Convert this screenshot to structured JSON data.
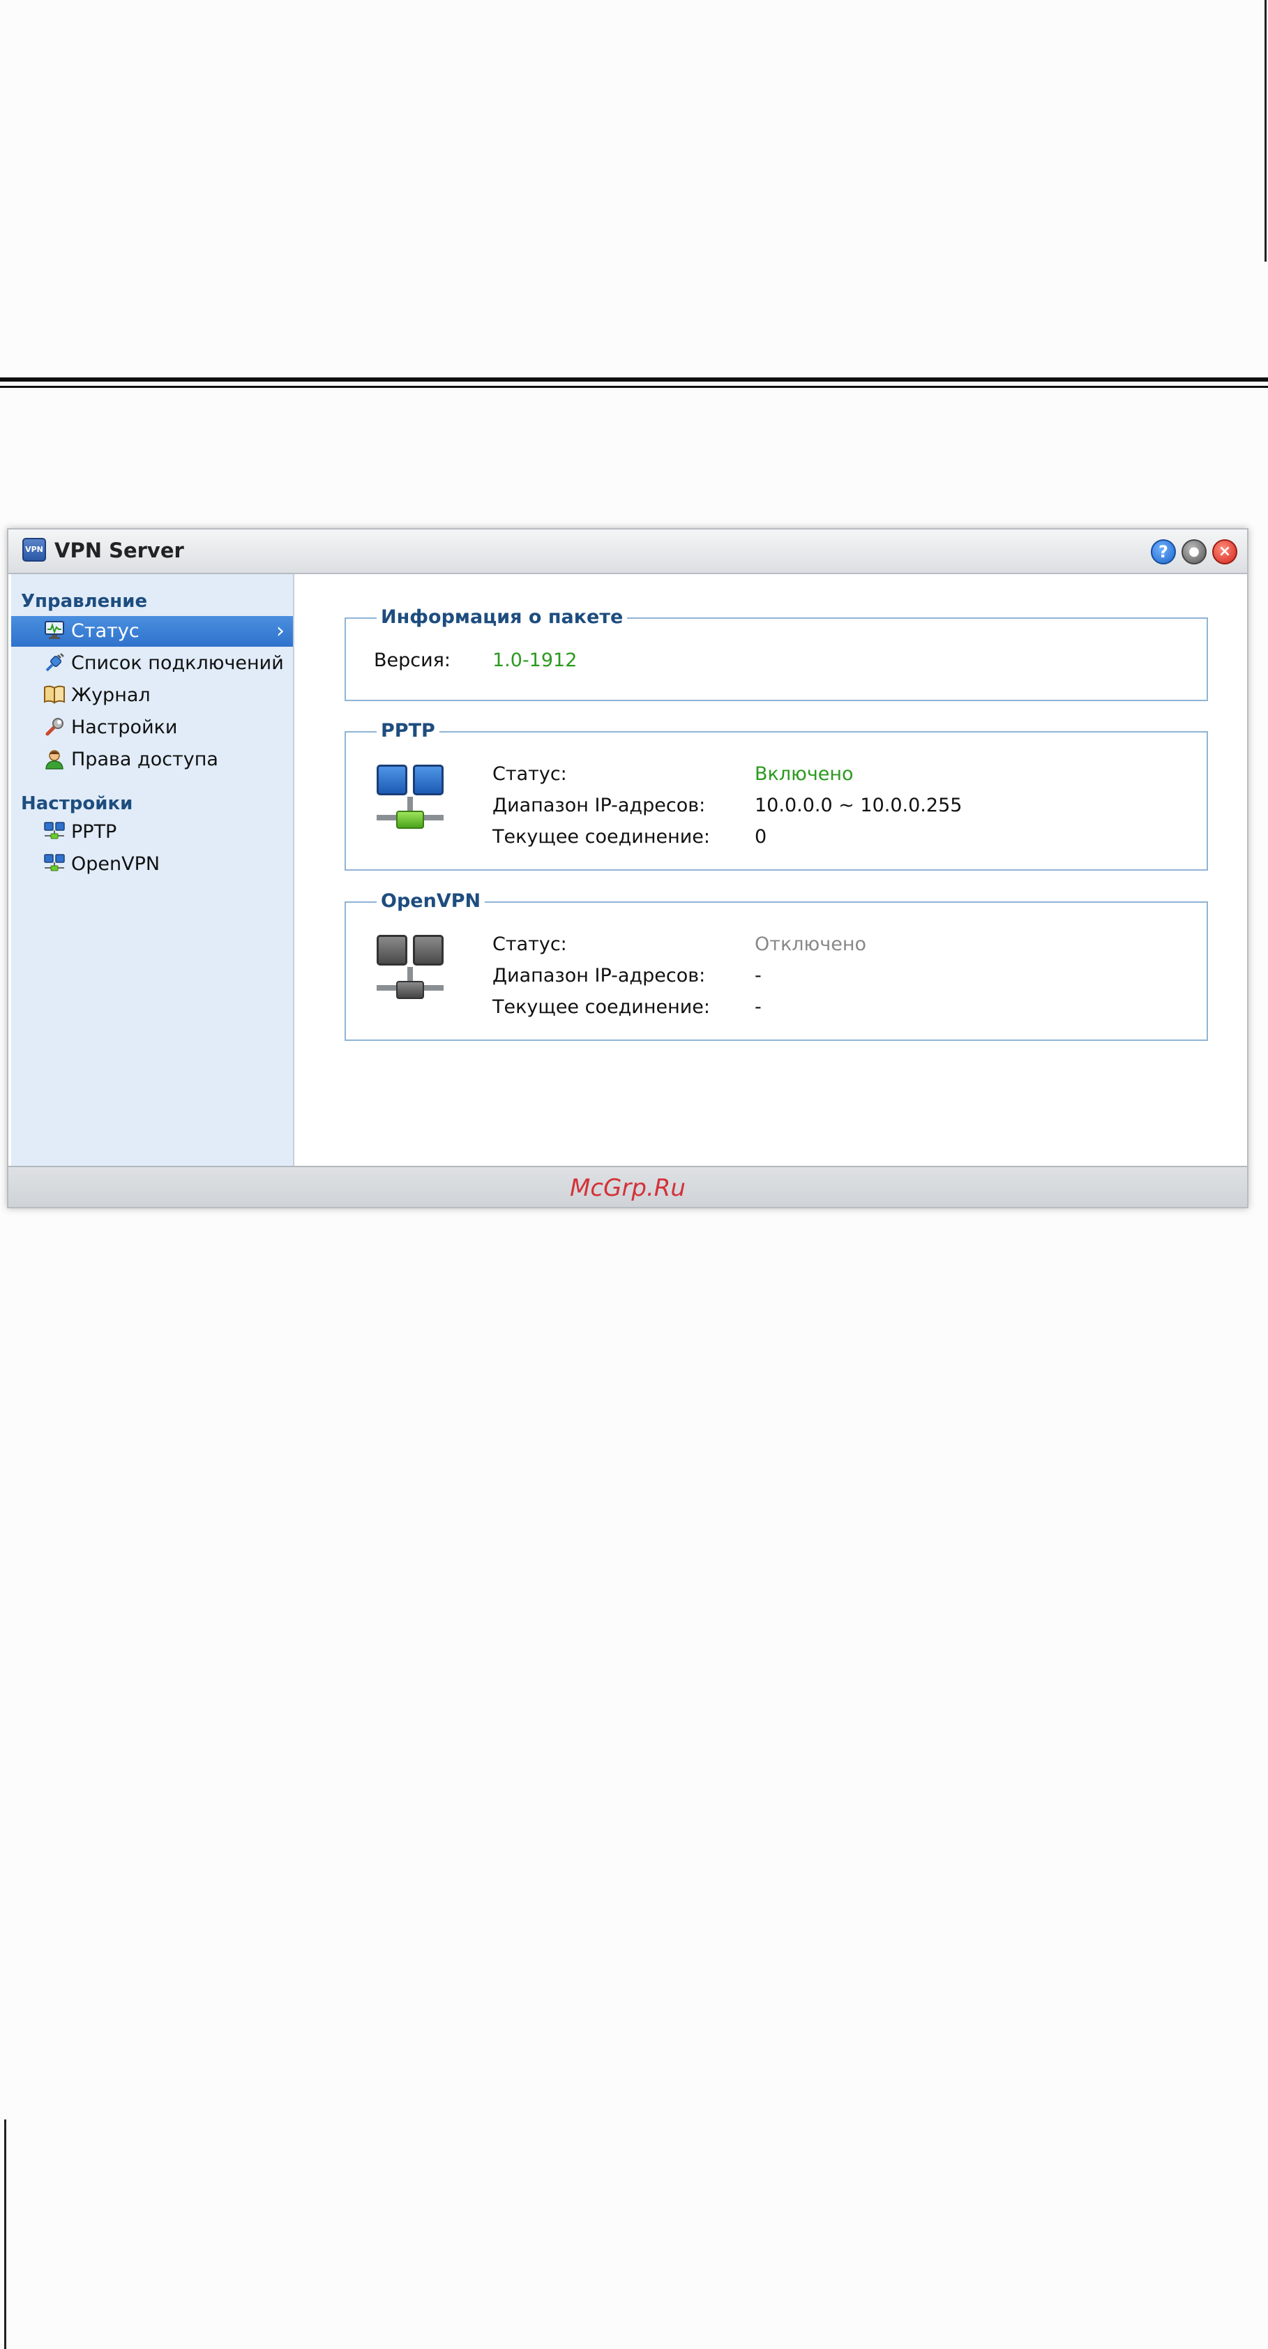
{
  "window": {
    "title": "VPN Server",
    "icon_text": "VPN"
  },
  "title_buttons": {
    "help": "?",
    "minimize": "●",
    "close": "×"
  },
  "sidebar": {
    "sections": [
      {
        "title": "Управление"
      },
      {
        "title": "Настройки"
      }
    ],
    "management_items": [
      {
        "label": "Статус",
        "icon": "monitor-icon",
        "selected": true
      },
      {
        "label": "Список подключений",
        "icon": "plug-icon"
      },
      {
        "label": "Журнал",
        "icon": "book-icon"
      },
      {
        "label": "Настройки",
        "icon": "wrench-icon"
      },
      {
        "label": "Права доступа",
        "icon": "user-icon"
      }
    ],
    "settings_items": [
      {
        "label": "PPTP",
        "icon": "network-icon"
      },
      {
        "label": "OpenVPN",
        "icon": "network-icon"
      }
    ]
  },
  "package_info": {
    "legend": "Информация о пакете",
    "version_label": "Версия:",
    "version_value": "1.0-1912"
  },
  "pptp": {
    "legend": "PPTP",
    "status_label": "Статус:",
    "status_value": "Включено",
    "ip_range_label": "Диапазон IP-адресов:",
    "ip_range_value": "10.0.0.0 ~ 10.0.0.255",
    "current_conn_label": "Текущее соединение:",
    "current_conn_value": "0"
  },
  "openvpn": {
    "legend": "OpenVPN",
    "status_label": "Статус:",
    "status_value": "Отключено",
    "ip_range_label": "Диапазон IP-адресов:",
    "ip_range_value": "-",
    "current_conn_label": "Текущее соединение:",
    "current_conn_value": "-"
  },
  "footer": {
    "watermark": "McGrp.Ru"
  },
  "colors": {
    "enabled": "#2a9a1e",
    "disabled": "#888888",
    "accent": "#2e72cc"
  }
}
